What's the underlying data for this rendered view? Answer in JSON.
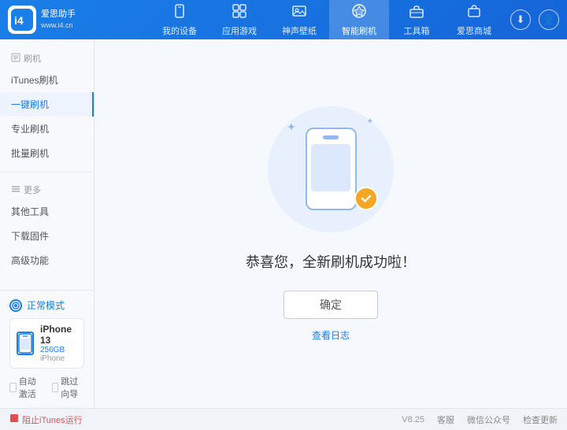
{
  "app": {
    "name": "爱思助手",
    "url": "www.i4.cn",
    "version": "V8.25"
  },
  "header": {
    "logo_text_line1": "爱思助手",
    "logo_text_line2": "www.i4.cn",
    "tabs": [
      {
        "id": "my-device",
        "label": "我的设备",
        "icon": "📱"
      },
      {
        "id": "apps-games",
        "label": "应用游戏",
        "icon": "🎮"
      },
      {
        "id": "wallpaper",
        "label": "神声壁纸",
        "icon": "🖼️"
      },
      {
        "id": "smart-flash",
        "label": "智能刷机",
        "icon": "🛡️",
        "active": true
      },
      {
        "id": "toolbox",
        "label": "工具箱",
        "icon": "🧰"
      },
      {
        "id": "store",
        "label": "爱思商城",
        "icon": "🛍️"
      }
    ]
  },
  "sidebar": {
    "section1": {
      "title": "刷机",
      "items": [
        {
          "id": "itunes-flash",
          "label": "iTunes刷机",
          "active": false
        },
        {
          "id": "one-key-flash",
          "label": "一键刷机",
          "active": true
        },
        {
          "id": "pro-flash",
          "label": "专业刷机",
          "active": false
        },
        {
          "id": "batch-flash",
          "label": "批量刷机",
          "active": false
        }
      ]
    },
    "section2": {
      "title": "更多",
      "items": [
        {
          "id": "other-tools",
          "label": "其他工具",
          "active": false
        },
        {
          "id": "download-fw",
          "label": "下载固件",
          "active": false
        },
        {
          "id": "advanced",
          "label": "高级功能",
          "active": false
        }
      ]
    }
  },
  "device": {
    "mode": "正常模式",
    "name": "iPhone 13",
    "storage": "256GB",
    "type": "iPhone"
  },
  "checkboxes": {
    "auto_activate": "自动激活",
    "skip_guide": "跳过向导"
  },
  "content": {
    "success_title": "恭喜您，全新刷机成功啦！",
    "confirm_btn": "确定",
    "view_log": "查看日志"
  },
  "footer": {
    "block_itunes": "阻止iTunes运行",
    "support": "客服",
    "wechat": "微信公众号",
    "check_update": "检查更新",
    "version": "V8.25"
  },
  "icons": {
    "logo": "i4",
    "download": "⬇",
    "user": "👤",
    "minimize": "—",
    "maximize": "□",
    "close": "✕",
    "checkmark": "✓",
    "stop": "■"
  }
}
